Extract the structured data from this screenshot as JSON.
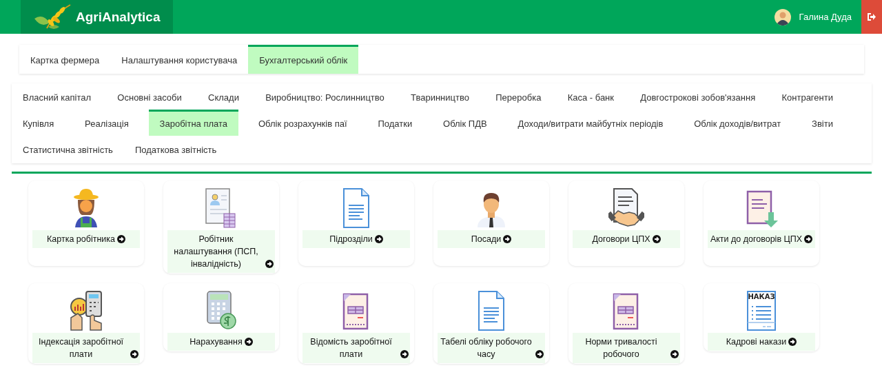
{
  "header": {
    "logo": "AgriAnalytica",
    "user_name": "Галина Дуда"
  },
  "main_tabs": [
    {
      "label": "Картка фермера",
      "selected": false
    },
    {
      "label": "Налаштування користувача",
      "selected": false
    },
    {
      "label": "Бухгалтерський облік",
      "selected": true
    }
  ],
  "section_tab_rows": [
    {
      "tabs": [
        {
          "label": "Власний капітал",
          "selected": false
        },
        {
          "label": "Основні засоби",
          "selected": false
        },
        {
          "label": "Склади",
          "selected": false
        },
        {
          "label": "Виробництво: Рослинництво",
          "selected": false
        },
        {
          "label": "Тваринництво",
          "selected": false
        },
        {
          "label": "Переробка",
          "selected": false
        },
        {
          "label": "Каса - банк",
          "selected": false
        },
        {
          "label": "Довгострокові зобов'язання",
          "selected": false
        },
        {
          "label": "Контрагенти",
          "selected": false
        }
      ]
    },
    {
      "tabs": [
        {
          "label": "Купівля",
          "selected": false
        },
        {
          "label": "Реалізація",
          "selected": false
        },
        {
          "label": "Заробітна плата",
          "selected": true
        },
        {
          "label": "Облік розрахунків паї",
          "selected": false
        },
        {
          "label": "Податки",
          "selected": false
        },
        {
          "label": "Облік ПДВ",
          "selected": false
        },
        {
          "label": "Доходи/витрати майбутніх періодів",
          "selected": false
        },
        {
          "label": "Облік доходів/витрат",
          "selected": false
        },
        {
          "label": "Звіти",
          "selected": false
        }
      ]
    },
    {
      "tabs": [
        {
          "label": "Статистична звітність",
          "selected": false
        },
        {
          "label": "Податкова звітність",
          "selected": false
        }
      ]
    }
  ],
  "cards": [
    {
      "label": "Картка робітника"
    },
    {
      "label": "Робітник налаштування (ПСП, інвалідність)"
    },
    {
      "label": "Підрозділи"
    },
    {
      "label": "Посади"
    },
    {
      "label": "Договори ЦПХ"
    },
    {
      "label": "Акти до договорів ЦПХ"
    },
    {
      "label": "Індексація заробітної плати"
    },
    {
      "label": "Нарахування"
    },
    {
      "label": "Відомість заробітної плати"
    },
    {
      "label": "Табелі обліку робочого часу"
    },
    {
      "label": "Норми тривалості робочого"
    },
    {
      "label": "Кадрові накази",
      "icon_text": "НАКАЗ"
    }
  ]
}
